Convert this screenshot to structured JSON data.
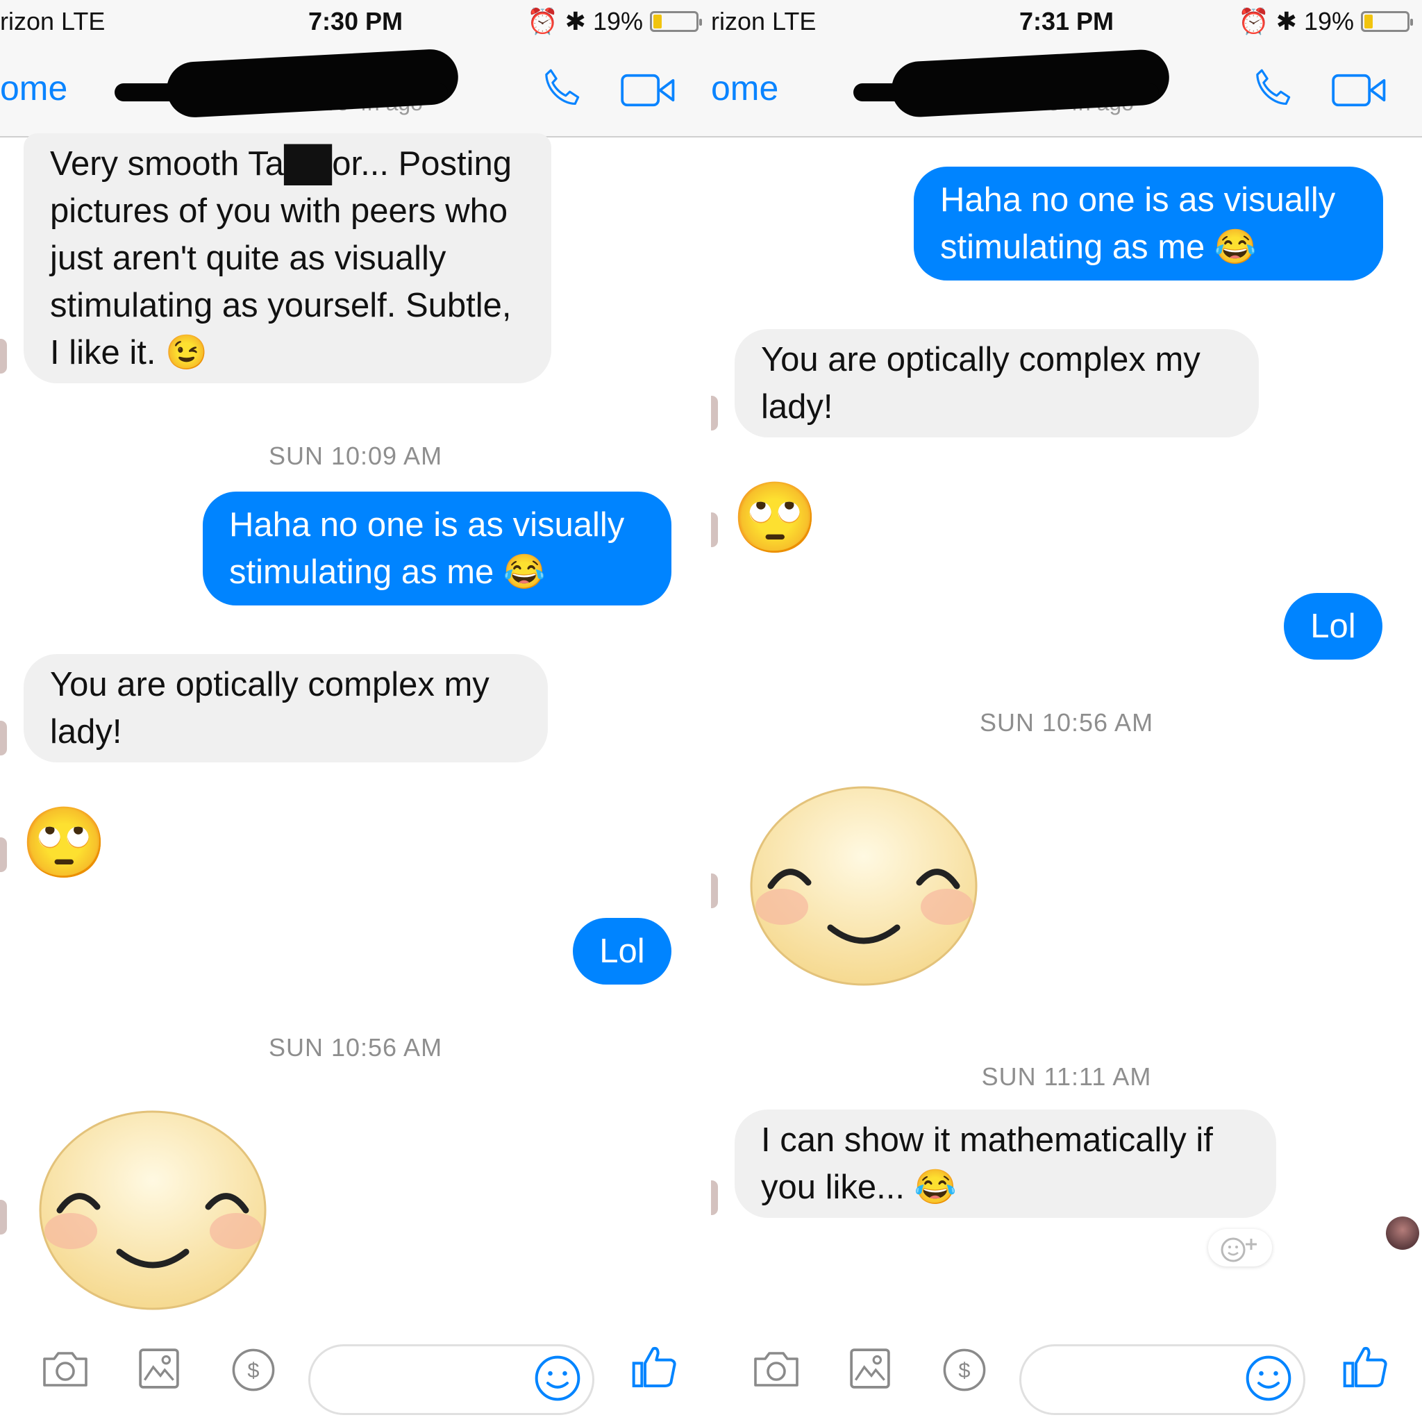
{
  "colors": {
    "accent": "#0084ff",
    "incoming_bubble": "#f0f0f0",
    "timestamp": "#8e8e8e",
    "battery_fill": "#f1c40f"
  },
  "left": {
    "status": {
      "carrier": "rizon  LTE",
      "time": "7:30 PM",
      "battery": "19%",
      "battery_level": 0.19
    },
    "nav": {
      "back": "ome",
      "active": "Active 4h ago"
    },
    "messages": {
      "m1": "Very smooth Ta██or... Posting pictures of you with peers who just aren't quite as visually stimulating as yourself. Subtle, I like it. 😉",
      "t1": "SUN 10:09 AM",
      "m2": "Haha no one is as visually stimulating as me 😂",
      "m3": "You are optically complex my lady!",
      "m4": "🙄",
      "m5": "Lol",
      "t2": "SUN 10:56 AM"
    },
    "composer": {
      "icons": [
        "camera-icon",
        "image-icon",
        "payment-icon",
        "emoji-icon",
        "thumbs-up-icon"
      ]
    }
  },
  "right": {
    "status": {
      "carrier": "rizon  LTE",
      "time": "7:31 PM",
      "battery": "19%",
      "battery_level": 0.19
    },
    "nav": {
      "back": "ome",
      "active": "Active 4h ago"
    },
    "messages": {
      "m1": "Haha no one is as visually stimulating as me 😂",
      "m2": "You are optically complex my lady!",
      "m3": "🙄",
      "m4": "Lol",
      "t1": "SUN 10:56 AM",
      "t2": "SUN 11:11 AM",
      "m5": "I can show it mathematically if you like... 😂"
    },
    "composer": {
      "icons": [
        "camera-icon",
        "image-icon",
        "payment-icon",
        "emoji-icon",
        "thumbs-up-icon"
      ]
    }
  }
}
